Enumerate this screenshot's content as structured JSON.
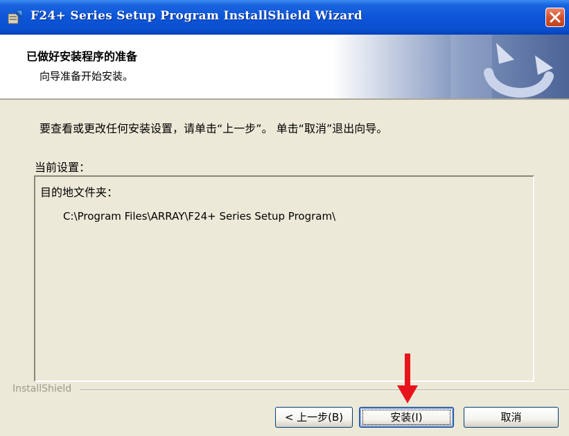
{
  "window": {
    "title": "F24+ Series Setup Program InstallShield Wizard"
  },
  "header": {
    "title": "已做好安装程序的准备",
    "subtitle": "向导准备开始安装。"
  },
  "body": {
    "instruction": "要查看或更改任何安装设置，请单击“上一步”。 单击“取消”退出向导。",
    "current_settings_label": "当前设置：",
    "destination_label": "目的地文件夹：",
    "destination_path": "C:\\Program Files\\ARRAY\\F24+ Series Setup Program\\"
  },
  "footer": {
    "brand": "InstallShield"
  },
  "buttons": {
    "back": "< 上一步(B)",
    "install": "安装(I)",
    "cancel": "取消"
  },
  "annotation": {
    "arrow_color": "#e8141c",
    "target": "install"
  },
  "icons": {
    "app": "installer-icon",
    "close": "close-icon",
    "logo": "installshield-logo"
  }
}
